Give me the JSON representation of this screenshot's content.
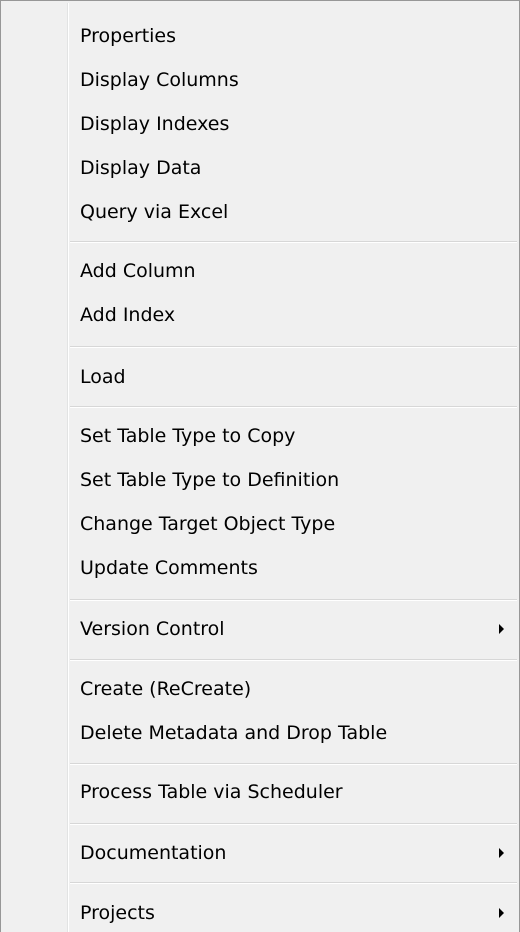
{
  "menu": {
    "items": [
      {
        "label": "Properties"
      },
      {
        "label": "Display Columns"
      },
      {
        "label": "Display Indexes"
      },
      {
        "label": "Display Data"
      },
      {
        "label": "Query via Excel"
      },
      {
        "label": "Add Column"
      },
      {
        "label": "Add Index"
      },
      {
        "label": "Load"
      },
      {
        "label": "Set Table Type to Copy"
      },
      {
        "label": "Set Table Type to Definition"
      },
      {
        "label": "Change Target Object Type"
      },
      {
        "label": "Update Comments"
      },
      {
        "label": "Version Control",
        "submenu": true
      },
      {
        "label": "Create (ReCreate)"
      },
      {
        "label": "Delete Metadata and Drop Table"
      },
      {
        "label": "Process Table via Scheduler"
      },
      {
        "label": "Documentation",
        "submenu": true
      },
      {
        "label": "Projects",
        "submenu": true
      }
    ]
  },
  "colors": {
    "menu_background": "#f0f0f0",
    "border": "#979797",
    "separator": "#d7d7d7",
    "text": "#000000"
  }
}
